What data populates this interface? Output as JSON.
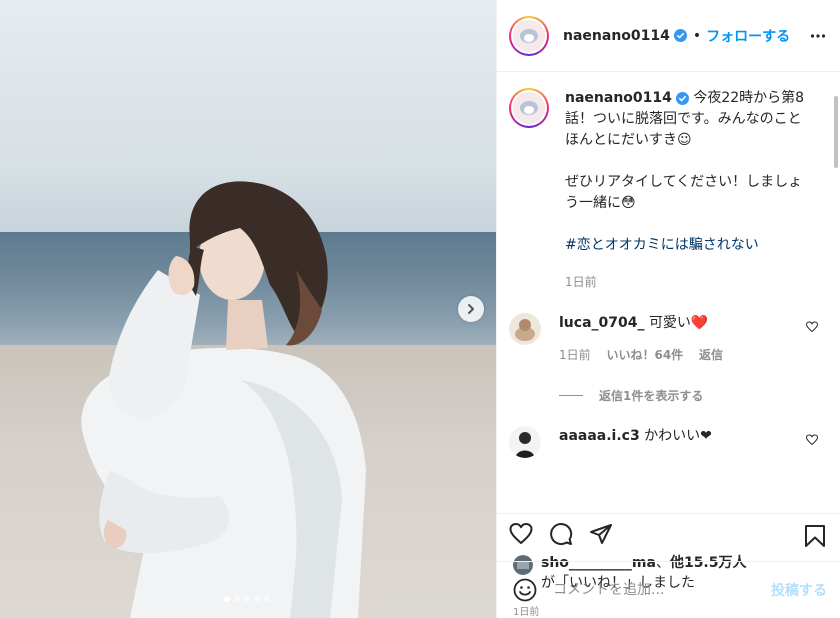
{
  "photo": {
    "next_icon": "chevron-right-icon",
    "carousel": {
      "count": 5,
      "active_index": 1
    }
  },
  "header": {
    "username": "naenano0114",
    "separator": "•",
    "follow_label": "フォローする",
    "more_icon": "more-horizontal-icon"
  },
  "caption": {
    "username": "naenano0114",
    "line1": "今夜22時から第8話！ついに脱落回です。みんなのことほんとにだいすき☺",
    "line2": "ぜひリアタイしてください！しましょう一緒に😳",
    "hashtag": "#恋とオオカミには騙されない",
    "time": "1日前"
  },
  "comments": [
    {
      "username": "luca_0704_",
      "text": "可愛い❤️",
      "time": "1日前",
      "likes": "いいね！64件",
      "reply_label": "返信",
      "view_replies": "返信1件を表示する"
    },
    {
      "username": "aaaaa.i.c3",
      "text": "かわいい❤"
    }
  ],
  "actions": {
    "like_icon": "heart-icon",
    "comment_icon": "comment-icon",
    "share_icon": "share-icon",
    "save_icon": "bookmark-icon"
  },
  "likes": {
    "username": "sho_________ma",
    "separator": "、",
    "others": "他15.5万人",
    "suffix": "が「いいね！」しました"
  },
  "post_time": "1日前",
  "add_comment": {
    "emoji_icon": "emoji-icon",
    "placeholder": "コメントを追加...",
    "post_label": "投稿する"
  },
  "colors": {
    "accent": "#0095f6",
    "verified": "#3897f0",
    "hashtag": "#00376b",
    "muted": "#8e8e8e",
    "heart": "#e0245e"
  }
}
